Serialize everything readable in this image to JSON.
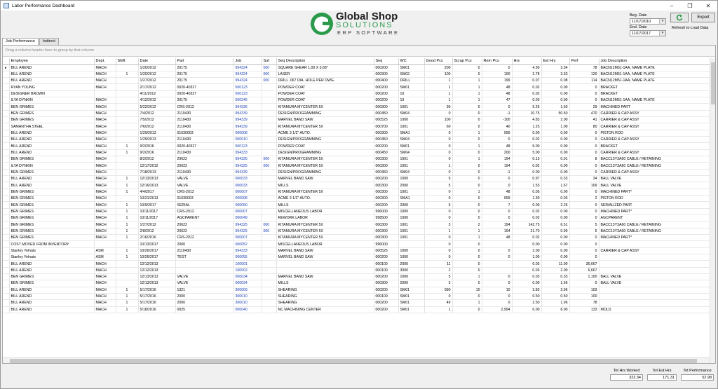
{
  "window": {
    "title": "Labor Performance Dashboard"
  },
  "logo": {
    "line1": "Global Shop",
    "line2": "SOLUTIONS",
    "line3": "ERP SOFTWARE"
  },
  "filters": {
    "beg_label": "Beg. Date",
    "beg_value": "11/17/2010",
    "end_label": "End. Date",
    "end_value": "11/17/2017"
  },
  "toolbar": {
    "export_label": "Export",
    "refresh_label": "Refresh to Load Data"
  },
  "tabs": [
    {
      "label": "Job Performance"
    },
    {
      "label": "Indirect"
    }
  ],
  "grid": {
    "group_hint": "Drag a column header here to group by that column",
    "columns": [
      "Employee",
      "Dept.",
      "Shift",
      "Date",
      "Part",
      "Job",
      "Suf",
      "Seq Description",
      "Seq",
      "WC",
      "Good Pcs",
      "Scrap Pcs",
      "Rem Pcs",
      "Hrs",
      "Est Hrs",
      "Perf",
      "Job Description"
    ],
    "rows": [
      [
        "BILL AREND",
        "MACH",
        "",
        "1/20/2012",
        "20175",
        "994324",
        "000",
        "SQUARE SHEAR 1.00 X 5.68\"",
        "000200",
        "SM01",
        "200",
        "0",
        "0",
        "4.30",
        "3.34",
        "78",
        "BACN12M51-1AA, NAME PLATE"
      ],
      [
        "BILL AREND",
        "MACH",
        "1",
        "1/20/2012",
        "20175",
        "994324",
        "000",
        "LASER",
        "000300",
        "SM02",
        "100",
        "0",
        "100",
        "2.78",
        "3.33",
        "120",
        "BACN12M51-1AA, NAME PLATE"
      ],
      [
        "BILL AREND",
        "MACH",
        "",
        "1/27/2012",
        "20175",
        "994324",
        "000",
        "DRILL .067 DIA. HOLE PER DWG.",
        "000400",
        "DRILL",
        "1",
        "1",
        "199",
        "0.07",
        "0.08",
        "114",
        "BACN12M51-1AA, NAME PLATE"
      ],
      [
        "RYAN YOUNG",
        "MACH",
        "",
        "2/17/2012",
        "0020-40327",
        "500123",
        "",
        "POWDER COAT",
        "000200",
        "SM01",
        "1",
        "1",
        "48",
        "0.02",
        "0.00",
        "0",
        "BRACKET"
      ],
      [
        "DESIGNER BROWN",
        "",
        "",
        "4/11/2012",
        "0020-40327",
        "500123",
        "",
        "POWDER COAT",
        "000200",
        "10",
        "1",
        "1",
        "48",
        "0.02",
        "0.00",
        "0",
        "BRACKET"
      ],
      [
        "ILYA DYNKIN",
        "MACH",
        "",
        "4/12/2012",
        "20175",
        "500345",
        "",
        "POWDER COAT",
        "000200",
        "10",
        "1",
        "1",
        "47",
        "0.03",
        "0.00",
        "0",
        "BACN12M51-1AA, NAME PLATE"
      ],
      [
        "BEN GRIMES",
        "MACH",
        "",
        "5/22/2012",
        "CRS-2012",
        "994336",
        "",
        "KITAMURA MYCENTER 5X",
        "000300",
        "1001",
        "30",
        "0",
        "0",
        "5.25",
        "1.50",
        "29",
        "MACHINED PART"
      ],
      [
        "BEN GRIMES",
        "MACH",
        "",
        "7/4/2012",
        "2110430",
        "994339",
        "",
        "DESIGN/PROGRAMMING",
        "000450",
        "SM04",
        "0",
        "0",
        "-1",
        "10.75",
        "50.50",
        "470",
        "CARRIER & CAP ASSY"
      ],
      [
        "BEN GRIMES",
        "MACH",
        "",
        "7/5/2012",
        "2110430",
        "994339",
        "",
        "MARVEL BAND SAW",
        "000525",
        "1000",
        "100",
        "0",
        "-100",
        "4.83",
        "2.00",
        "41",
        "CARRIER & CAP ASSY"
      ],
      [
        "SAMANTHA STEEL",
        "MACH",
        "",
        "7/6/2012",
        "2110430",
        "994339",
        "",
        "KITAMURA MYCENTER 5X",
        "000700",
        "1001",
        "60",
        "0",
        "40",
        "1.25",
        "1.00",
        "80",
        "CARRIER & CAP ASSY"
      ],
      [
        "BILL AREND",
        "MACH",
        "",
        "1/29/2013",
        "01030003",
        "000008",
        "",
        "ACME 3 1/2\" AUTO.",
        "000300",
        "SMA1",
        "0",
        "1",
        "999",
        "0.00",
        "0.00",
        "0",
        "PISTON ROD"
      ],
      [
        "BILL AREND",
        "MACH",
        "",
        "1/29/2013",
        "2110430",
        "000010",
        "",
        "DESIGN/PROGRAMMING",
        "000450",
        "SM04",
        "0",
        "0",
        "0",
        "0.02",
        "0.00",
        "0",
        "CARRIER & CAP ASSY"
      ],
      [
        "BILL AREND",
        "MACH",
        "1",
        "9/2/2016",
        "0020-40327",
        "500123",
        "",
        "POWDER COAT",
        "000200",
        "SM01",
        "0",
        "1",
        "48",
        "5.00",
        "0.00",
        "0",
        "BRACKET"
      ],
      [
        "BILL AREND",
        "MACH",
        "1",
        "9/2/2016",
        "2110430",
        "994333",
        "",
        "DESIGN/PROGRAMMING",
        "000450",
        "SM04",
        "0",
        "0",
        "200",
        "5.00",
        "0.00",
        "0",
        "CARRIER & CAP ASSY"
      ],
      [
        "BEN GRIMES",
        "MACH",
        "",
        "8/2/2012",
        "20622",
        "994325",
        "000",
        "KITAMURA MYCENTER 5X",
        "000300",
        "1001",
        "0",
        "1",
        "194",
        "0.13",
        "0.01",
        "8",
        "BACC13Y3A60 CABLE / RETAINING"
      ],
      [
        "ILYA DYNKIN",
        "MACH",
        "",
        "12/17/2012",
        "20622",
        "994325",
        "000",
        "KITAMURA MYCENTER 5X",
        "000300",
        "1001",
        "1",
        "0",
        "194",
        "0.02",
        "0.00",
        "0",
        "BACC13Y3A60 CABLE / RETAINING"
      ],
      [
        "BEN GRIMES",
        "MACH",
        "",
        "7/18/2013",
        "2110430",
        "994339",
        "",
        "DESIGN/PROGRAMMING",
        "000450",
        "SM04",
        "0",
        "0",
        "-1",
        "0.00",
        "0.00",
        "0",
        "CARRIER & CAP ASSY"
      ],
      [
        "BILL AREND",
        "MACH",
        "1",
        "12/13/2013",
        "VALVE",
        "000033",
        "",
        "MARVEL BAND SAW",
        "000200",
        "1000",
        "5",
        "0",
        "0",
        "0.97",
        "0.33",
        "34",
        "BALL VALVE"
      ],
      [
        "BILL AREND",
        "MACH",
        "1",
        "12/16/2013",
        "VALVE",
        "000033",
        "",
        "MILLS",
        "000300",
        "2000",
        "5",
        "0",
        "0",
        "1.53",
        "1.67",
        "109",
        "BALL VALVE"
      ],
      [
        "BEN GRIMES",
        "MACH",
        "1",
        "4/4/2017",
        "CRS-2012",
        "000007",
        "",
        "KITAMURA MYCENTER 5X",
        "000300",
        "1001",
        "0",
        "1",
        "48",
        "0.05",
        "0.00",
        "0",
        "MACHINED PART*"
      ],
      [
        "BEN GRIMES",
        "MACH",
        "",
        "10/21/2013",
        "01030003",
        "000008",
        "",
        "ACME 3 1/2\" AUTO.",
        "000300",
        "SMA1",
        "0",
        "0",
        "999",
        "1.30",
        "0.03",
        "2",
        "PISTON ROD"
      ],
      [
        "BEN GRIMES",
        "MACH",
        "1",
        "10/9/2017",
        "SERIAL",
        "000050",
        "",
        "MILLS",
        "000200",
        "2000",
        "5",
        "0",
        "7",
        "0.00",
        "2.25",
        "0",
        "SERIALIZED PART"
      ],
      [
        "BEN GRIMES",
        "MACH",
        "1",
        "10/11/2017",
        "CRS-2012",
        "000007",
        "",
        "MISCELLANEOUS LABOR",
        "996000",
        "1000",
        "0",
        "0",
        "0",
        "0.02",
        "0.00",
        "0",
        "MACHINED PART*"
      ],
      [
        "BEN GRIMES",
        "MACH",
        "1",
        "10/11/2017",
        "AGCPARENT",
        "000049",
        "",
        "REWORK LABOR",
        "998500",
        "1000",
        "0",
        "0",
        "0",
        "0.02",
        "0.00",
        "0",
        "AGCPARENT"
      ],
      [
        "BEN GRIMES",
        "MACH",
        "1",
        "1/27/2012",
        "20622",
        "994325",
        "000",
        "KITAMURA MYCENTER 5X",
        "000300",
        "1001",
        "3",
        "2",
        "194",
        "142.75",
        "6.51",
        "5",
        "BACC13Y3A60 CABLE / RETAINING"
      ],
      [
        "BEN GRIMES",
        "MACH",
        "1",
        "2/8/2012",
        "20622",
        "994325",
        "000",
        "KITAMURA MYCENTER 5X",
        "000300",
        "1001",
        "1",
        "1",
        "194",
        "21.70",
        "0.99",
        "5",
        "BACC13Y3A60 CABLE / RETAINING"
      ],
      [
        "BEN GRIMES",
        "MACH",
        "1",
        "2/16/2016",
        "CRS-2012",
        "000007",
        "",
        "KITAMURA MYCENTER 5X",
        "000300",
        "1001",
        "0",
        "1",
        "48",
        "0.02",
        "0.00",
        "0",
        "MACHINED PART*"
      ],
      [
        "COST MOVED FROM INVENTORY",
        "",
        "",
        "10/13/2017",
        "2000",
        "000052",
        "",
        "MISCELLANEOUS LABOR",
        "996000",
        "",
        "0",
        "0",
        "",
        "0.00",
        "0.00",
        "0",
        ""
      ],
      [
        "Stanley Yelnats",
        "ASM",
        "1",
        "10/26/2017",
        "2110430",
        "994333",
        "",
        "MARVEL BAND SAW",
        "000525",
        "1000",
        "0",
        "0",
        "0",
        "2.00",
        "0.00",
        "0",
        "CARRIER & CAP ASSY"
      ],
      [
        "Stanley Yelnats",
        "ASM",
        "1",
        "10/26/2017",
        "TEST",
        "000055",
        "",
        "MARVEL BAND SAW",
        "000200",
        "1000",
        "0",
        "0",
        "0",
        "1.00",
        "0.00",
        "0",
        ""
      ],
      [
        "BILL AREND",
        "MACH",
        "",
        "12/12/2013",
        "",
        "100001",
        "",
        "",
        "000100",
        "2000",
        "11",
        "0",
        "",
        "0.03",
        "11.00",
        "36,667",
        ""
      ],
      [
        "BILL AREND",
        "MACH",
        "",
        "12/12/2013",
        "",
        "100002",
        "",
        "",
        "000100",
        "3000",
        "2",
        "0",
        "",
        "0.03",
        "2.00",
        "6,667",
        ""
      ],
      [
        "BEN GRIMES",
        "MACH",
        "",
        "12/13/2013",
        "VALVE",
        "000034",
        "",
        "MARVEL BAND SAW",
        "000200",
        "1000",
        "5",
        "1",
        "0",
        "0.03",
        "0.33",
        "1,100",
        "BALL VALVE"
      ],
      [
        "BEN GRIMES",
        "MACH",
        "",
        "12/13/2013",
        "VALVE",
        "000034",
        "",
        "MILLS",
        "000300",
        "2000",
        "5",
        "0",
        "0",
        "0.00",
        "1.66",
        "0",
        "BALL VALVE"
      ],
      [
        "BILL AREND",
        "MACH",
        "1",
        "5/17/2016",
        "1321",
        "300009",
        "",
        "SHEARING",
        "000200",
        "SM01",
        "990",
        "10",
        "10",
        "3.83",
        "3.96",
        "103",
        ""
      ],
      [
        "BILL AREND",
        "MACH",
        "1",
        "5/17/2016",
        "2000",
        "300010",
        "",
        "SHEARING",
        "000100",
        "SM01",
        "0",
        "0",
        "0",
        "0.50",
        "0.50",
        "100",
        ""
      ],
      [
        "BILL AREND",
        "MACH",
        "1",
        "5/17/2016",
        "2000",
        "300010",
        "",
        "SHEARING",
        "000200",
        "SM01",
        "49",
        "1",
        "0",
        "2.50",
        "1.96",
        "78",
        ""
      ],
      [
        "BILL AREND",
        "MACH",
        "1",
        "5/18/2016",
        "0025",
        "000040",
        "",
        "NC MACHINING CENTER",
        "000200",
        "SM01",
        "1",
        "0",
        "2,994",
        "6.00",
        "8.00",
        "133",
        "MOLD"
      ]
    ]
  },
  "totals": {
    "hrs_label": "Tot Hrs Worked",
    "hrs_value": "323.34",
    "est_label": "Tot Est Hrs",
    "est_value": "171.31",
    "perf_label": "Tot Performance",
    "perf_value": "52.98"
  }
}
